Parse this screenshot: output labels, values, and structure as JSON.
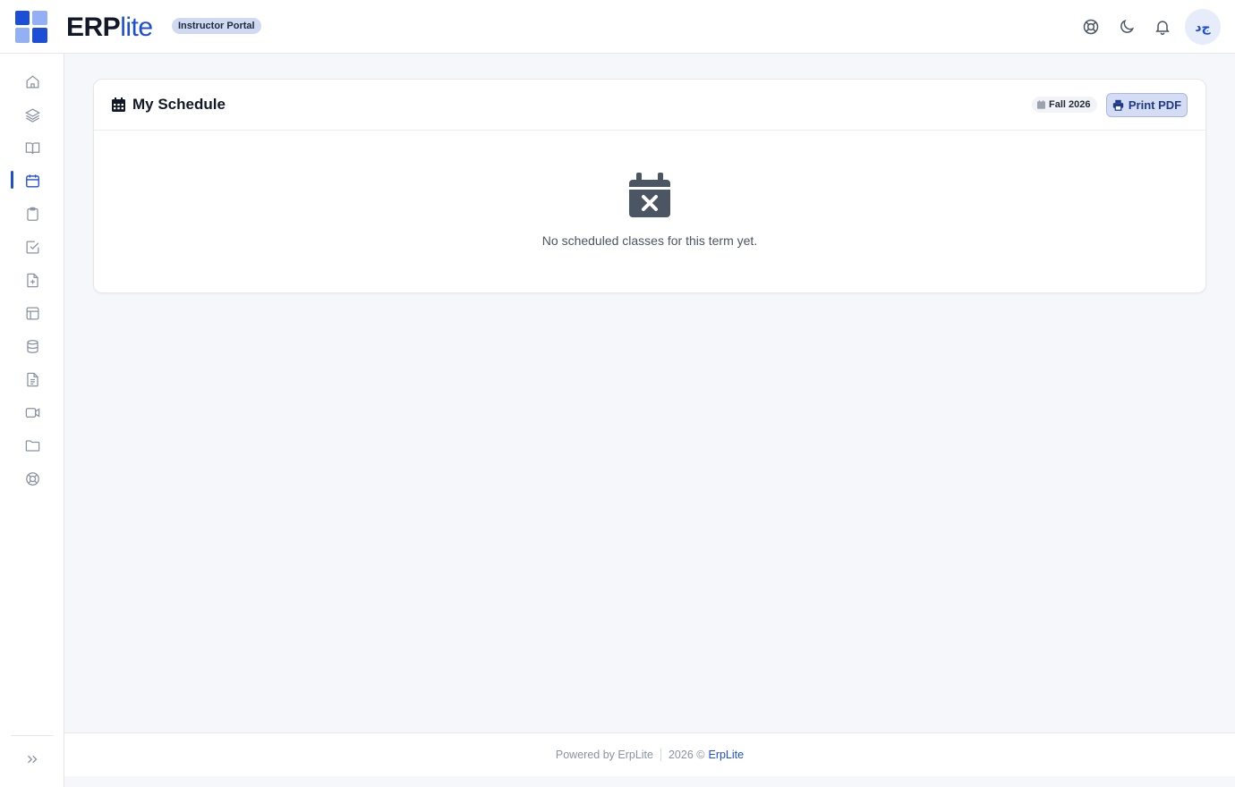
{
  "header": {
    "brand_main": "ERP",
    "brand_accent": "lite",
    "portal_badge": "Instructor Portal",
    "avatar_initials": "ﺝﺩ",
    "icons": [
      "lifebuoy-icon",
      "moon-icon",
      "bell-icon"
    ]
  },
  "sidebar": {
    "items": [
      {
        "name": "home-icon"
      },
      {
        "name": "layers-icon"
      },
      {
        "name": "book-icon"
      },
      {
        "name": "calendar-icon",
        "active": true
      },
      {
        "name": "clipboard-icon"
      },
      {
        "name": "check-square-icon"
      },
      {
        "name": "file-plus-icon"
      },
      {
        "name": "layout-icon"
      },
      {
        "name": "database-icon"
      },
      {
        "name": "file-text-icon"
      },
      {
        "name": "video-icon"
      },
      {
        "name": "folder-icon"
      },
      {
        "name": "lifebuoy-icon"
      }
    ],
    "expand_icon": "chevrons-right-icon"
  },
  "schedule": {
    "title": "My Schedule",
    "term": "Fall 2026",
    "print_label": "Print PDF",
    "empty_message": "No scheduled classes for this term yet."
  },
  "footer": {
    "powered_by": "Powered by ErpLite",
    "copyright": "2026 ©",
    "link_text": "ErpLite"
  },
  "colors": {
    "accent": "#1d4ed8",
    "background": "#f5f7fb",
    "badge_bg": "#cfd9f1"
  }
}
